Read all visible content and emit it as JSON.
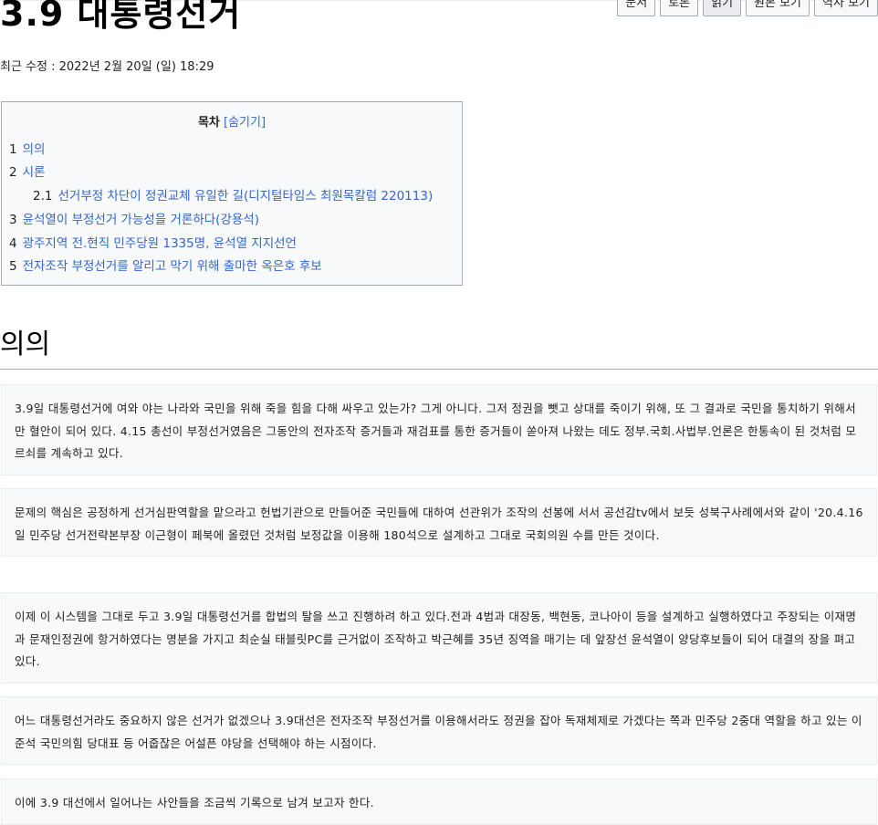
{
  "page": {
    "title": "3.9 대통령선거",
    "last_modified": "최근 수정 : 2022년 2월 20일 (일) 18:29"
  },
  "actions": [
    {
      "label": "문서"
    },
    {
      "label": "토론"
    },
    {
      "label": "읽기"
    },
    {
      "label": "원본 보기"
    },
    {
      "label": "역사 보기"
    }
  ],
  "toc": {
    "title": "목차",
    "toggle": "[숨기기]",
    "items": [
      {
        "num": "1",
        "label": "의의"
      },
      {
        "num": "2",
        "label": "시론"
      },
      {
        "num": "2.1",
        "label": "선거부정 차단이 정권교체 유일한 길(디지털타임스 최원목칼럼 220113)"
      },
      {
        "num": "3",
        "label": "윤석열이 부정선거 가능성을 거론하다(강용석)"
      },
      {
        "num": "4",
        "label": "광주지역 전.현직 민주당원 1335명, 윤석열 지지선언"
      },
      {
        "num": "5",
        "label": "전자조작 부정선거를 알리고 막기 위해 출마한 옥은호 후보"
      }
    ]
  },
  "section": {
    "heading": "의의"
  },
  "paragraphs": [
    "3.9일 대통령선거에 여와 야는 나라와 국민을 위해 죽을 힘을 다해 싸우고 있는가? 그게 아니다. 그저 정권을 뺏고 상대를 죽이기 위해, 또 그 결과로 국민을 통치하기 위해서만 혈안이 되어 있다. 4.15 총선이 부정선거였음은 그동안의 전자조작 증거들과 재검표를 통한 증거들이 쏟아져 나왔는 데도 정부.국회.사법부.언론은 한통속이 된 것처럼 모르쇠를 계속하고 있다.",
    "문제의 핵심은 공정하게 선거심판역할을 맡으라고 헌법기관으로 만들어준 국민들에 대하여 선관위가 조작의 선봉에 서서 공선감tv에서 보듯 성북구사례에서와 같이 '20.4.16일 민주당 선거전략본부장 이근형이 페북에 올렸던 것처럼 보정값을 이용해 180석으로 설계하고 그대로 국회의원 수를 만든 것이다.",
    "이제 이 시스템을 그대로 두고 3.9일 대통령선거를 합법의 탈을 쓰고 진행하려 하고 있다.전과 4범과 대장동, 백현동, 코나아이 등을 설계하고 실행하였다고 주장되는 이재명과 문재인정권에 항거하였다는 명분을 가지고 최순실 태블릿PC를 근거없이 조작하고 박근혜를 35년 징역을 매기는 데 앞장선 윤석열이 양당후보들이 되어 대결의 장을 펴고 있다.",
    "어느 대통령선거라도 중요하지 않은 선거가 없겠으나 3.9대선은 전자조작 부정선거를 이용해서라도 정권을 잡아 독재체제로 가겠다는 쪽과 민주당 2중대 역할을 하고 있는 이준석 국민의힘 당대표 등 어줍잖은 어설픈 야당을 선택해야 하는 시점이다.",
    "이에 3.9 대선에서 일어나는 사안들을 조금씩 기록으로 남겨 보고자 한다."
  ],
  "colors": {
    "link": "#3366cc",
    "box_bg": "#f8f9fa",
    "border": "#a2a9b1"
  }
}
